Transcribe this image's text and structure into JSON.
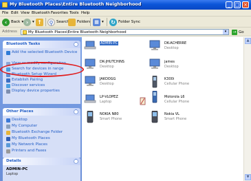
{
  "window": {
    "title": "My Bluetooth Places\\Entire Bluetooth Neighborhood",
    "min_glyph": "_",
    "max_glyph": "□",
    "close_glyph": "×"
  },
  "menu": [
    "File",
    "Edit",
    "View",
    "Bluetooth",
    "Favorites",
    "Tools",
    "Help"
  ],
  "toolbar": {
    "back_label": "Back",
    "search_label": "Search",
    "folders_label": "Folders",
    "folder_sync_label": "Folder Sync",
    "back_glyph": "‹",
    "forward_glyph": "›",
    "up_glyph": "↑",
    "views_glyph": "▦",
    "dropdown_glyph": "▾"
  },
  "address": {
    "label": "Address",
    "value": "My Bluetooth Places\\Entire Bluetooth Neighborhood",
    "go_label": "Go",
    "go_glyph": "→",
    "dropdown_glyph": "▾"
  },
  "bluetooth_tasks": {
    "title": "Bluetooth Tasks",
    "toggle_glyph": "˄",
    "items": [
      "Add the selected Bluetooth Device",
      "View or modify configuration",
      "Search for devices in range",
      "Bluetooth Setup Wizard",
      "Establish Pairing",
      "Discover services",
      "Display device properties"
    ]
  },
  "other_places": {
    "title": "Other Places",
    "toggle_glyph": "˄",
    "items": [
      "Desktop",
      "My Computer",
      "Bluetooth Exchange Folder",
      "My Bluetooth Places",
      "My Network Places",
      "Printers and Faxes"
    ]
  },
  "details": {
    "title": "Details",
    "toggle_glyph": "˄",
    "name": "ADMIN-PC",
    "type": "Laptop"
  },
  "devices": [
    {
      "name": "ADMIN-PC",
      "type": "Laptop",
      "icon": "laptop-icon",
      "selected": true
    },
    {
      "name": "DK-ACHERRE",
      "type": "Desktop",
      "icon": "desktop-icon"
    },
    {
      "name": "DK-JHUTCHINS",
      "type": "Desktop",
      "icon": "desktop-icon"
    },
    {
      "name": "james",
      "type": "Desktop",
      "icon": "desktop-icon"
    },
    {
      "name": "JAKOOGG",
      "type": "Desktop",
      "icon": "desktop-icon"
    },
    {
      "name": "K300i",
      "type": "Cellular Phone",
      "icon": "cellphone-icon"
    },
    {
      "name": "LP-VLOPEZ",
      "type": "Laptop",
      "icon": "laptop-icon"
    },
    {
      "name": "Motorola L6",
      "type": "Cellular Phone",
      "icon": "cellphone-icon"
    },
    {
      "name": "NOKIA N80",
      "type": "Smart Phone",
      "icon": "smartphone-icon"
    },
    {
      "name": "Nokia VL",
      "type": "Smart Phone",
      "icon": "smartphone-icon"
    }
  ],
  "scrollbar": {
    "up_glyph": "▲",
    "down_glyph": "▼"
  },
  "colors": {
    "title_bar": "#0b55d8",
    "task_pane": "#6b8fd8",
    "link_text": "#215dc6",
    "selection": "#316ac5",
    "annotation": "#e01b1b"
  }
}
